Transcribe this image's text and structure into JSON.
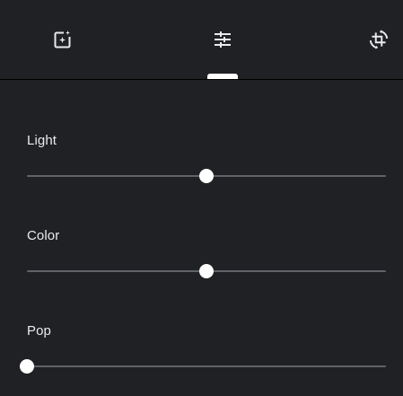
{
  "tabs": [
    {
      "name": "suggestions",
      "icon": "auto-fix-icon",
      "active": false
    },
    {
      "name": "adjust",
      "icon": "tune-sliders-icon",
      "active": true
    },
    {
      "name": "crop",
      "icon": "crop-rotate-icon",
      "active": false
    }
  ],
  "adjust": {
    "sliders": [
      {
        "label": "Light",
        "value": 0.5
      },
      {
        "label": "Color",
        "value": 0.5
      },
      {
        "label": "Pop",
        "value": 0.0
      }
    ]
  },
  "colors": {
    "background": "#202124",
    "text": "#e8eaed",
    "track": "#5f6368",
    "thumb": "#ffffff",
    "icon": "#e8eaed"
  }
}
